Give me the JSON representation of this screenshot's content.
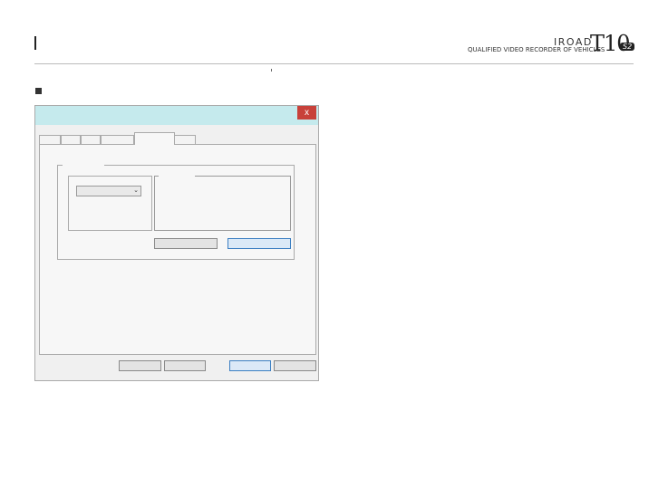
{
  "header": {
    "brand": "IROAD",
    "model": "T10",
    "model_badge": "S2",
    "tagline": "QUALIFIED VIDEO RECORDER OF VEHICLES"
  },
  "dialog": {
    "close_glyph": "x",
    "colors": {
      "titlebar": "#c5eaed",
      "close_button": "#c8413a",
      "primary_button_border": "#3c7fc2"
    },
    "combo_arrow_glyph": "⌄"
  }
}
